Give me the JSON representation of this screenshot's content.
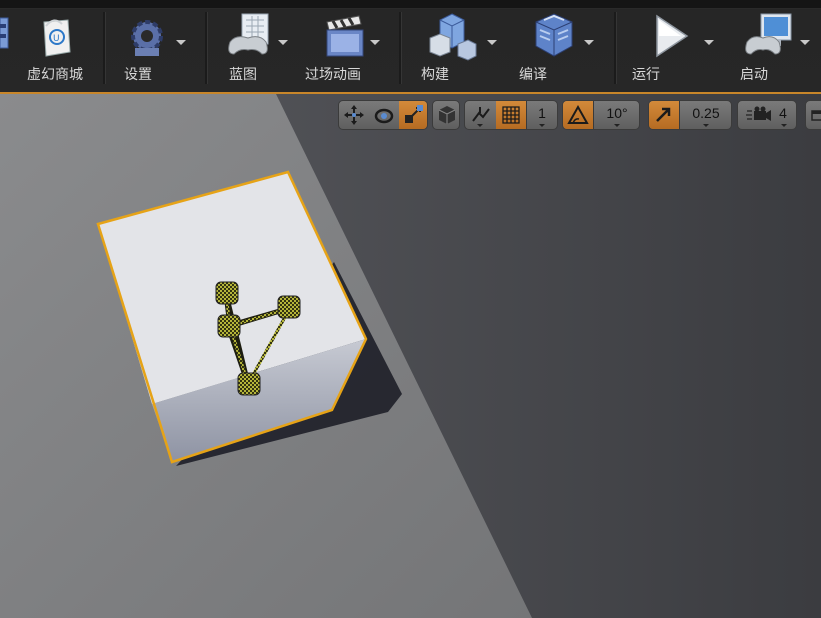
{
  "toolbar": {
    "buttons": [
      {
        "label": "虚幻商城",
        "icon": "marketplace-icon"
      },
      {
        "label": "设置",
        "icon": "settings-gear-icon"
      },
      {
        "label": "蓝图",
        "icon": "blueprint-gamepad-icon"
      },
      {
        "label": "过场动画",
        "icon": "cinematics-clapper-icon"
      },
      {
        "label": "构建",
        "icon": "build-cubes-icon"
      },
      {
        "label": "编译",
        "icon": "compile-cubes-icon"
      },
      {
        "label": "运行",
        "icon": "play-icon"
      },
      {
        "label": "启动",
        "icon": "launch-monitor-icon"
      }
    ]
  },
  "viewport_toolbar": {
    "translate": {
      "icon": "translate-move-icon",
      "active": false
    },
    "rotate": {
      "icon": "rotate-icon",
      "active": false
    },
    "scale": {
      "icon": "scale-icon",
      "active": true
    },
    "world_local": {
      "icon": "world-cube-icon"
    },
    "surface_snap": {
      "icon": "surface-snap-icon"
    },
    "grid_snap": {
      "icon": "grid-snap-icon",
      "active": true,
      "value": "1"
    },
    "rotation_snap": {
      "icon": "rotation-snap-icon",
      "active": true,
      "value": "10°"
    },
    "scale_snap": {
      "icon": "scale-snap-icon",
      "active": true,
      "value": "0.25"
    },
    "camera_speed": {
      "icon": "camera-speed-icon",
      "value": "4"
    },
    "maximize": {
      "icon": "maximize-viewport-icon"
    }
  },
  "colors": {
    "accent": "#e8a02a",
    "selection_outline": "#e6a317",
    "active_button": "#c77d2e",
    "toolbar_bg": "#262626",
    "floor": "#7f8082",
    "background": "#45464a"
  },
  "scene": {
    "selected_actor": {
      "type": "cube",
      "selected": true
    },
    "actor_icon": "node-graph-icon"
  }
}
